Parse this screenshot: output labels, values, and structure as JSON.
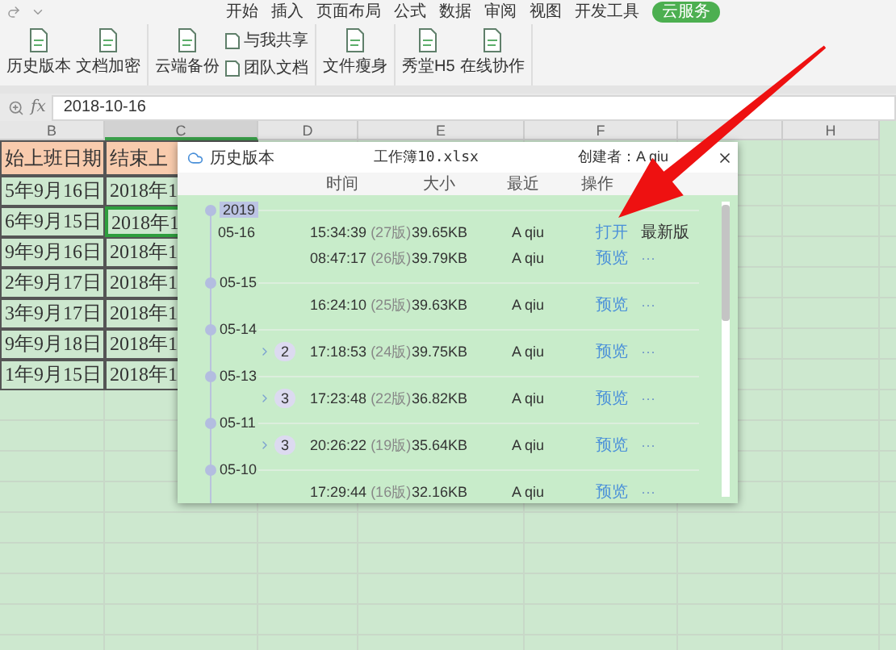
{
  "ribbon_tabs": [
    {
      "label": "开始",
      "selected": false
    },
    {
      "label": "插入",
      "selected": false
    },
    {
      "label": "页面布局",
      "selected": false
    },
    {
      "label": "公式",
      "selected": false
    },
    {
      "label": "数据",
      "selected": false
    },
    {
      "label": "审阅",
      "selected": false
    },
    {
      "label": "视图",
      "selected": false
    },
    {
      "label": "开发工具",
      "selected": false
    },
    {
      "label": "云服务",
      "selected": true
    }
  ],
  "ribbon_groups": [
    [
      {
        "label": "历史版本",
        "kind": "large"
      },
      {
        "label": "文档加密",
        "kind": "large"
      }
    ],
    [
      {
        "label": "云端备份",
        "kind": "large"
      },
      {
        "label": "与我共享",
        "kind": "small"
      },
      {
        "label": "团队文档",
        "kind": "small"
      }
    ],
    [
      {
        "label": "文件瘦身",
        "kind": "large"
      }
    ],
    [
      {
        "label": "秀堂H5",
        "kind": "large"
      },
      {
        "label": "在线协作",
        "kind": "large"
      }
    ]
  ],
  "formula_bar": {
    "label": "fx",
    "value": "2018-10-16"
  },
  "columns": [
    {
      "label": "B",
      "selected": false
    },
    {
      "label": "C",
      "selected": true
    },
    {
      "label": "D",
      "selected": false
    },
    {
      "label": "E",
      "selected": false
    },
    {
      "label": "F",
      "selected": false
    },
    {
      "selected": false
    },
    {
      "label": "H",
      "selected": false
    }
  ],
  "rows": [
    {
      "kind": "header",
      "cells": [
        {
          "text": "始上班日期",
          "selected": false
        },
        {
          "text": "结束上",
          "selected": false
        }
      ]
    },
    {
      "kind": "data",
      "cells": [
        {
          "text": "5年9月16日",
          "selected": false
        },
        {
          "text": "2018年1",
          "selected": false
        }
      ]
    },
    {
      "kind": "data",
      "cells": [
        {
          "text": "6年9月15日",
          "selected": false
        },
        {
          "text": "2018年1",
          "selected": true
        }
      ]
    },
    {
      "kind": "data",
      "cells": [
        {
          "text": "9年9月16日",
          "selected": false
        },
        {
          "text": "2018年1",
          "selected": false
        }
      ]
    },
    {
      "kind": "data",
      "cells": [
        {
          "text": "2年9月17日",
          "selected": false
        },
        {
          "text": "2018年1",
          "selected": false
        }
      ]
    },
    {
      "kind": "data",
      "cells": [
        {
          "text": "3年9月17日",
          "selected": false
        },
        {
          "text": "2018年1",
          "selected": false
        }
      ]
    },
    {
      "kind": "data",
      "cells": [
        {
          "text": "9年9月18日",
          "selected": false
        },
        {
          "text": "2018年1",
          "selected": false
        }
      ]
    },
    {
      "kind": "data",
      "cells": [
        {
          "text": "1年9月15日",
          "selected": false
        },
        {
          "text": "2018年1",
          "selected": false
        }
      ]
    }
  ],
  "dialog": {
    "title": "历史版本",
    "file": "工作簿10.xlsx",
    "creator": "创建者：A qiu",
    "columns": [
      "时间",
      "大小",
      "最近",
      "操作"
    ],
    "groups": [
      {
        "year": "2019",
        "date": "05-16",
        "entries": [
          {
            "time": "15:34:39",
            "version": "(27版)",
            "size": "39.65KB",
            "user": "A qiu",
            "action": "打开",
            "extra": "最新版"
          },
          {
            "time": "08:47:17",
            "version": "(26版)",
            "size": "39.79KB",
            "user": "A qiu",
            "action": "预览",
            "extra": "···"
          }
        ]
      },
      {
        "date": "05-15",
        "entries": [
          {
            "time": "16:24:10",
            "version": "(25版)",
            "size": "39.63KB",
            "user": "A qiu",
            "action": "预览",
            "extra": "···"
          }
        ]
      },
      {
        "date": "05-14",
        "entries": [
          {
            "count": "2",
            "time": "17:18:53",
            "version": "(24版)",
            "size": "39.75KB",
            "user": "A qiu",
            "action": "预览",
            "extra": "···"
          }
        ]
      },
      {
        "date": "05-13",
        "entries": [
          {
            "count": "3",
            "time": "17:23:48",
            "version": "(22版)",
            "size": "36.82KB",
            "user": "A qiu",
            "action": "预览",
            "extra": "···"
          }
        ]
      },
      {
        "date": "05-11",
        "entries": [
          {
            "count": "3",
            "time": "20:26:22",
            "version": "(19版)",
            "size": "35.64KB",
            "user": "A qiu",
            "action": "预览",
            "extra": "···"
          }
        ]
      },
      {
        "date": "05-10",
        "entries": [
          {
            "time": "17:29:44",
            "version": "(16版)",
            "size": "32.16KB",
            "user": "A qiu",
            "action": "预览",
            "extra": "···"
          }
        ]
      }
    ]
  }
}
